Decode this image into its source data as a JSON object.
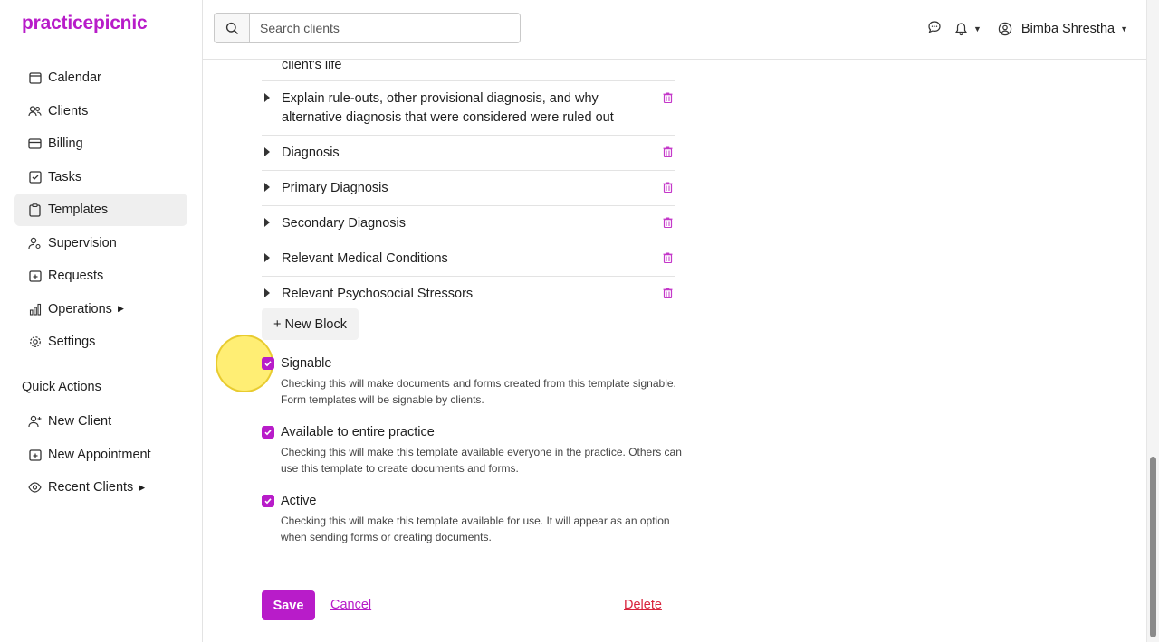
{
  "app": {
    "logo": "practicepicnic",
    "brand_color": "#b81cc9"
  },
  "sidebar": {
    "items": [
      {
        "label": "Calendar",
        "icon": "calendar-icon"
      },
      {
        "label": "Clients",
        "icon": "users-icon"
      },
      {
        "label": "Billing",
        "icon": "credit-card-icon"
      },
      {
        "label": "Tasks",
        "icon": "checkbox-icon"
      },
      {
        "label": "Templates",
        "icon": "clipboard-icon",
        "active": true
      },
      {
        "label": "Supervision",
        "icon": "user-gear-icon"
      },
      {
        "label": "Requests",
        "icon": "calendar-plus-icon"
      },
      {
        "label": "Operations",
        "icon": "bar-chart-icon",
        "has_submenu": true
      },
      {
        "label": "Settings",
        "icon": "gear-icon"
      }
    ],
    "quick_actions_title": "Quick Actions",
    "quick_actions": [
      {
        "label": "New Client",
        "icon": "user-plus-icon"
      },
      {
        "label": "New Appointment",
        "icon": "calendar-plus-icon"
      },
      {
        "label": "Recent Clients",
        "icon": "eye-icon",
        "has_submenu": true
      }
    ]
  },
  "header": {
    "search_placeholder": "Search clients",
    "user_name": "Bimba Shrestha"
  },
  "blocks": [
    {
      "title": "client's life"
    },
    {
      "title": "Explain rule-outs, other provisional diagnosis, and why alternative diagnosis that were considered were ruled out"
    },
    {
      "title": "Diagnosis"
    },
    {
      "title": "Primary Diagnosis"
    },
    {
      "title": "Secondary Diagnosis"
    },
    {
      "title": "Relevant Medical Conditions"
    },
    {
      "title": "Relevant Psychosocial Stressors"
    }
  ],
  "new_block_label": "+ New Block",
  "options": {
    "signable": {
      "label": "Signable",
      "desc": "Checking this will make documents and forms created from this template signable. Form templates will be signable by clients.",
      "checked": true
    },
    "available": {
      "label": "Available to entire practice",
      "desc": "Checking this will make this template available everyone in the practice. Others can use this template to create documents and forms.",
      "checked": true
    },
    "active": {
      "label": "Active",
      "desc": "Checking this will make this template available for use. It will appear as an option when sending forms or creating documents.",
      "checked": true
    }
  },
  "actions": {
    "save": "Save",
    "cancel": "Cancel",
    "delete": "Delete"
  }
}
